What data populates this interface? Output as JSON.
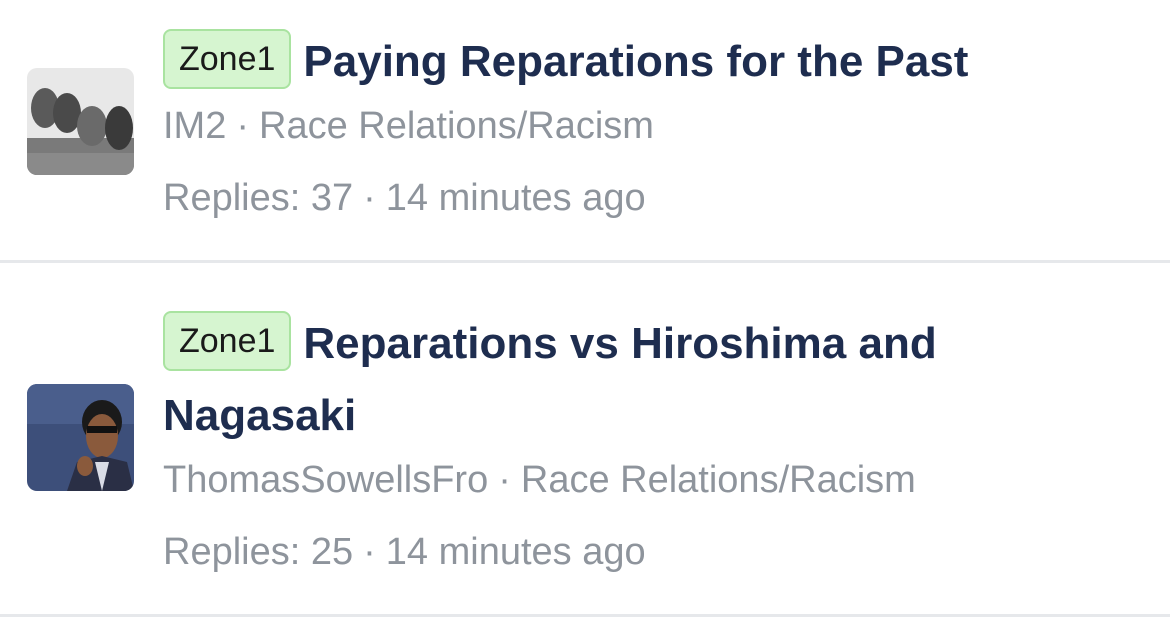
{
  "threads": [
    {
      "badge": "Zone1",
      "title": "Paying Reparations for the Past",
      "author": "IM2",
      "separator": "·",
      "category": "Race Relations/Racism",
      "replies_text": "Replies: 37",
      "time": "14 minutes ago",
      "avatar_icon": "carved-faces-avatar"
    },
    {
      "badge": "Zone1",
      "title": "Reparations vs Hiroshima and Nagasaki",
      "author": "ThomasSowellsFro",
      "separator": "·",
      "category": "Race Relations/Racism",
      "replies_text": "Replies: 25",
      "time": "14 minutes ago",
      "avatar_icon": "man-portrait-avatar"
    }
  ],
  "colors": {
    "title": "#1e2d4f",
    "meta": "#8e949c",
    "badge_bg": "#d6f5d0",
    "badge_border": "#a9e3a0",
    "divider": "#e6e8eb"
  }
}
